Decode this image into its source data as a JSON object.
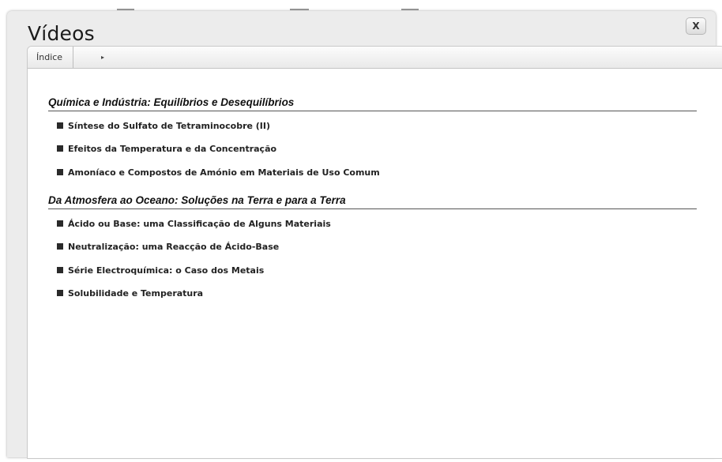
{
  "window": {
    "title": "Vídeos",
    "close_label": "X"
  },
  "tabs": {
    "index_label": "Índice",
    "arrow_label": "▸"
  },
  "sections": [
    {
      "title": "Química e Indústria: Equilíbrios e Desequilíbrios",
      "items": [
        {
          "label": "Síntese do Sulfato de Tetraminocobre (II)"
        },
        {
          "label": "Efeitos da Temperatura e da Concentração"
        },
        {
          "label": "Amoníaco e Compostos de Amónio em Materiais de Uso Comum"
        }
      ]
    },
    {
      "title": "Da Atmosfera ao Oceano: Soluções na Terra e para a Terra",
      "items": [
        {
          "label": "Ácido ou Base: uma Classificação de Alguns Materiais"
        },
        {
          "label": "Neutralização: uma Reacção de Ácido-Base"
        },
        {
          "label": "Série Electroquímica: o Caso dos Metais"
        },
        {
          "label": "Solubilidade e Temperatura"
        }
      ]
    }
  ]
}
